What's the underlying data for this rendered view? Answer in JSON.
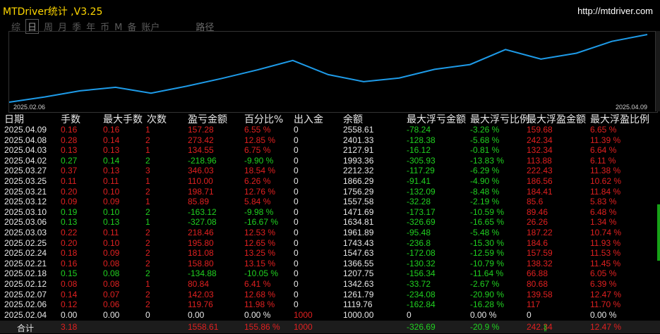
{
  "app": {
    "title": "MTDriver统计 ,V3.25",
    "url": "http://mtdriver.com"
  },
  "tabs": [
    {
      "label": "综",
      "active": false
    },
    {
      "label": "日",
      "active": true
    },
    {
      "label": "周",
      "active": false
    },
    {
      "label": "月",
      "active": false
    },
    {
      "label": "季",
      "active": false
    },
    {
      "label": "年",
      "active": false
    },
    {
      "label": "币",
      "active": false
    },
    {
      "label": "M",
      "active": false
    },
    {
      "label": "备",
      "active": false
    },
    {
      "label": "账户",
      "active": false
    },
    {
      "label": "路径",
      "active": false
    }
  ],
  "chart": {
    "start_label": "2025.02.06",
    "end_label": "2025.04.09",
    "line_color": "#1e9be8",
    "balance_series": [
      1000.0,
      1119.76,
      1261.79,
      1342.63,
      1207.75,
      1366.55,
      1547.63,
      1743.43,
      1961.89,
      1634.81,
      1471.69,
      1557.58,
      1756.29,
      1866.29,
      2212.32,
      1993.36,
      2127.91,
      2401.33,
      2558.61
    ]
  },
  "columns": {
    "date": "日期",
    "lots": "手数",
    "max_lots": "最大手数",
    "count": "次数",
    "pnl": "盈亏金额",
    "pct": "百分比%",
    "deposit": "出入金",
    "balance": "余额",
    "max_float_loss": "最大浮亏金额",
    "max_float_loss_pct": "最大浮亏比例",
    "max_float_profit": "最大浮盈金额",
    "max_float_profit_pct": "最大浮盈比例"
  },
  "rows": [
    {
      "date": "2025.04.09",
      "lots": "0.16",
      "max_lots": "0.16",
      "count": "1",
      "pnl": "157.28",
      "pct": "6.55 %",
      "deposit": "0",
      "balance": "2558.61",
      "mfl": "-78.24",
      "mflp": "-3.26 %",
      "mfp": "159.68",
      "mfpp": "6.65 %",
      "sign": "pos"
    },
    {
      "date": "2025.04.08",
      "lots": "0.28",
      "max_lots": "0.14",
      "count": "2",
      "pnl": "273.42",
      "pct": "12.85 %",
      "deposit": "0",
      "balance": "2401.33",
      "mfl": "-128.38",
      "mflp": "-5.68 %",
      "mfp": "242.34",
      "mfpp": "11.39 %",
      "sign": "pos"
    },
    {
      "date": "2025.04.03",
      "lots": "0.13",
      "max_lots": "0.13",
      "count": "1",
      "pnl": "134.55",
      "pct": "6.75 %",
      "deposit": "0",
      "balance": "2127.91",
      "mfl": "-16.12",
      "mflp": "-0.81 %",
      "mfp": "132.34",
      "mfpp": "6.64 %",
      "sign": "pos"
    },
    {
      "date": "2025.04.02",
      "lots": "0.27",
      "max_lots": "0.14",
      "count": "2",
      "pnl": "-218.96",
      "pct": "-9.90 %",
      "deposit": "0",
      "balance": "1993.36",
      "mfl": "-305.93",
      "mflp": "-13.83 %",
      "mfp": "113.88",
      "mfpp": "6.11 %",
      "sign": "neg"
    },
    {
      "date": "2025.03.27",
      "lots": "0.37",
      "max_lots": "0.13",
      "count": "3",
      "pnl": "346.03",
      "pct": "18.54 %",
      "deposit": "0",
      "balance": "2212.32",
      "mfl": "-117.29",
      "mflp": "-6.29 %",
      "mfp": "222.43",
      "mfpp": "11.38 %",
      "sign": "pos"
    },
    {
      "date": "2025.03.25",
      "lots": "0.11",
      "max_lots": "0.11",
      "count": "1",
      "pnl": "110.00",
      "pct": "6.26 %",
      "deposit": "0",
      "balance": "1866.29",
      "mfl": "-91.41",
      "mflp": "-4.90 %",
      "mfp": "186.56",
      "mfpp": "10.62 %",
      "sign": "pos"
    },
    {
      "date": "2025.03.21",
      "lots": "0.20",
      "max_lots": "0.10",
      "count": "2",
      "pnl": "198.71",
      "pct": "12.76 %",
      "deposit": "0",
      "balance": "1756.29",
      "mfl": "-132.09",
      "mflp": "-8.48 %",
      "mfp": "184.41",
      "mfpp": "11.84 %",
      "sign": "pos"
    },
    {
      "date": "2025.03.12",
      "lots": "0.09",
      "max_lots": "0.09",
      "count": "1",
      "pnl": "85.89",
      "pct": "5.84 %",
      "deposit": "0",
      "balance": "1557.58",
      "mfl": "-32.28",
      "mflp": "-2.19 %",
      "mfp": "85.6",
      "mfpp": "5.83 %",
      "sign": "pos"
    },
    {
      "date": "2025.03.10",
      "lots": "0.19",
      "max_lots": "0.10",
      "count": "2",
      "pnl": "-163.12",
      "pct": "-9.98 %",
      "deposit": "0",
      "balance": "1471.69",
      "mfl": "-173.17",
      "mflp": "-10.59 %",
      "mfp": "89.46",
      "mfpp": "6.48 %",
      "sign": "neg"
    },
    {
      "date": "2025.03.06",
      "lots": "0.13",
      "max_lots": "0.13",
      "count": "1",
      "pnl": "-327.08",
      "pct": "-16.67 %",
      "deposit": "0",
      "balance": "1634.81",
      "mfl": "-326.69",
      "mflp": "-16.65 %",
      "mfp": "26.26",
      "mfpp": "1.34 %",
      "sign": "neg"
    },
    {
      "date": "2025.03.03",
      "lots": "0.22",
      "max_lots": "0.11",
      "count": "2",
      "pnl": "218.46",
      "pct": "12.53 %",
      "deposit": "0",
      "balance": "1961.89",
      "mfl": "-95.48",
      "mflp": "-5.48 %",
      "mfp": "187.22",
      "mfpp": "10.74 %",
      "sign": "pos"
    },
    {
      "date": "2025.02.25",
      "lots": "0.20",
      "max_lots": "0.10",
      "count": "2",
      "pnl": "195.80",
      "pct": "12.65 %",
      "deposit": "0",
      "balance": "1743.43",
      "mfl": "-236.8",
      "mflp": "-15.30 %",
      "mfp": "184.6",
      "mfpp": "11.93 %",
      "sign": "pos"
    },
    {
      "date": "2025.02.24",
      "lots": "0.18",
      "max_lots": "0.09",
      "count": "2",
      "pnl": "181.08",
      "pct": "13.25 %",
      "deposit": "0",
      "balance": "1547.63",
      "mfl": "-172.08",
      "mflp": "-12.59 %",
      "mfp": "157.59",
      "mfpp": "11.53 %",
      "sign": "pos"
    },
    {
      "date": "2025.02.21",
      "lots": "0.16",
      "max_lots": "0.08",
      "count": "2",
      "pnl": "158.80",
      "pct": "13.15 %",
      "deposit": "0",
      "balance": "1366.55",
      "mfl": "-130.32",
      "mflp": "-10.79 %",
      "mfp": "138.32",
      "mfpp": "11.45 %",
      "sign": "pos"
    },
    {
      "date": "2025.02.18",
      "lots": "0.15",
      "max_lots": "0.08",
      "count": "2",
      "pnl": "-134.88",
      "pct": "-10.05 %",
      "deposit": "0",
      "balance": "1207.75",
      "mfl": "-156.34",
      "mflp": "-11.64 %",
      "mfp": "66.88",
      "mfpp": "6.05 %",
      "sign": "neg"
    },
    {
      "date": "2025.02.12",
      "lots": "0.08",
      "max_lots": "0.08",
      "count": "1",
      "pnl": "80.84",
      "pct": "6.41 %",
      "deposit": "0",
      "balance": "1342.63",
      "mfl": "-33.72",
      "mflp": "-2.67 %",
      "mfp": "80.68",
      "mfpp": "6.39 %",
      "sign": "pos"
    },
    {
      "date": "2025.02.07",
      "lots": "0.14",
      "max_lots": "0.07",
      "count": "2",
      "pnl": "142.03",
      "pct": "12.68 %",
      "deposit": "0",
      "balance": "1261.79",
      "mfl": "-234.08",
      "mflp": "-20.90 %",
      "mfp": "139.58",
      "mfpp": "12.47 %",
      "sign": "pos"
    },
    {
      "date": "2025.02.06",
      "lots": "0.12",
      "max_lots": "0.06",
      "count": "2",
      "pnl": "119.76",
      "pct": "11.98 %",
      "deposit": "0",
      "balance": "1119.76",
      "mfl": "-162.84",
      "mflp": "-16.28 %",
      "mfp": "117",
      "mfpp": "11.70 %",
      "sign": "pos"
    },
    {
      "date": "2025.02.04",
      "lots": "0.00",
      "max_lots": "0.00",
      "count": "0",
      "pnl": "0.00",
      "pct": "0.00 %",
      "deposit": "1000",
      "balance": "1000.00",
      "mfl": "0",
      "mflp": "0.00 %",
      "mfp": "0",
      "mfpp": "0.00 %",
      "sign": "zero"
    }
  ],
  "total": {
    "label": "合计",
    "lots": "3.18",
    "pnl": "1558.61",
    "pct": "155.86 %",
    "deposit": "1000",
    "mfl": "-326.69",
    "mflp": "-20.9 %",
    "mfp": "242.34",
    "mfpp": "12.47 %"
  }
}
